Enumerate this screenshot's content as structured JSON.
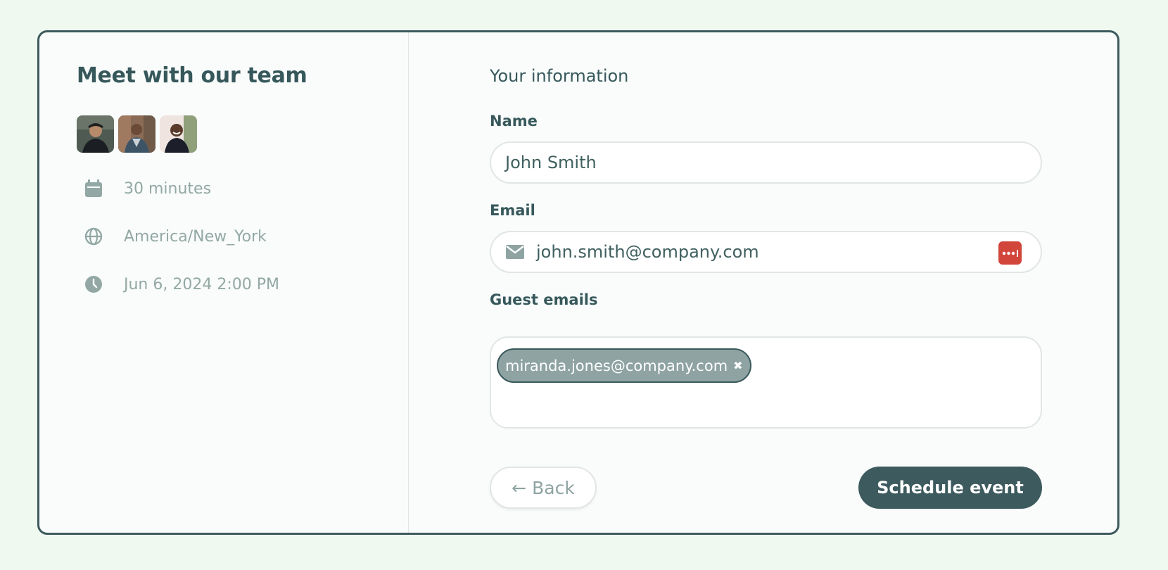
{
  "left_panel": {
    "title": "Meet with our team",
    "avatars": [
      {
        "icon": "team-member-avatar-1"
      },
      {
        "icon": "team-member-avatar-2"
      },
      {
        "icon": "team-member-avatar-3"
      }
    ],
    "details": [
      {
        "icon": "calendar-icon",
        "text": "30 minutes"
      },
      {
        "icon": "globe-icon",
        "text": "America/New_York"
      },
      {
        "icon": "clock-icon",
        "text": "Jun 6, 2024 2:00 PM"
      }
    ]
  },
  "form": {
    "section_title": "Your information",
    "name": {
      "label": "Name",
      "value": "John Smith"
    },
    "email": {
      "label": "Email",
      "value": "john.smith@company.com",
      "icon": "mail-icon",
      "autofill_icon": "password-manager-icon"
    },
    "guests": {
      "label": "Guest emails",
      "chips": [
        "miranda.jones@company.com"
      ],
      "remove_glyph": "✖"
    },
    "back_button": {
      "arrow": "←",
      "label": "Back"
    },
    "submit_button": {
      "label": "Schedule event"
    }
  },
  "colors": {
    "page_bg": "#eff9ef",
    "card_bg": "#f9fcfb",
    "primary": "#3d5a5e",
    "muted_text": "#93a8a4",
    "chip_bg": "#8ea3a2",
    "autofill_red": "#d1453b"
  }
}
